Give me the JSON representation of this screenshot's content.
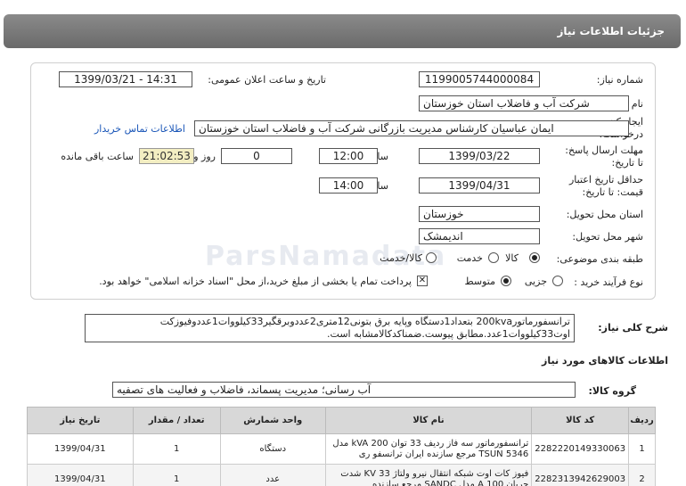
{
  "header": {
    "title": "جزئیات اطلاعات نیاز"
  },
  "form": {
    "need_number_label": "شماره نیاز:",
    "need_number": "1199005744000084",
    "announce_label": "تاریخ و ساعت اعلان عمومی:",
    "announce_value": "1399/03/21 - 14:31",
    "buyer_label": "نام دستگاه خریدار:",
    "buyer_value": "شرکت آب و فاضلاب استان خوزستان",
    "creator_label_1": "ایجاد کننده",
    "creator_label_2": "درخواست:",
    "creator_value": "ایمان عباسیان کارشناس مدیریت بازرگانی شرکت آب و فاضلاب استان خوزستان",
    "contact_link": "اطلاعات تماس خریدار",
    "reply_label_1": "مهلت ارسال پاسخ:",
    "reply_label_2": "تا تاریخ:",
    "reply_date": "1399/03/22",
    "time_label": "ساعت",
    "reply_time": "12:00",
    "days_value": "0",
    "days_label": "روز و",
    "remaining_time": "21:02:53",
    "remaining_label": "ساعت باقی مانده",
    "validity_label_1": "حداقل تاریخ اعتبار",
    "validity_label_2": "قیمت: تا تاریخ:",
    "validity_date": "1399/04/31",
    "validity_time": "14:00",
    "province_label": "استان محل تحویل:",
    "province_value": "خوزستان",
    "city_label": "شهر محل تحویل:",
    "city_value": "اندیمشک",
    "category_label": "طبقه بندی موضوعی:",
    "category_options": [
      "کالا",
      "خدمت",
      "کالا/خدمت"
    ],
    "process_label": "نوع فرآیند خرید :",
    "process_options": [
      "جزیی",
      "متوسط"
    ],
    "payment_note": "پرداخت تمام یا بخشی از مبلغ خرید،از محل \"اسناد خزانه اسلامی\" خواهد بود."
  },
  "description": {
    "label": "شرح کلی نیاز:",
    "text": "ترانسفورماتور200kva بتعداد1دستگاه وپایه برق بتونی12متری2عددوبرقگیر33کیلووات1عددوفیوزکت اوت33کیلووات1عدد.مطابق پیوست.ضمناکدکالامشابه است."
  },
  "goods_section": {
    "title": "اطلاعات کالاهای مورد نیاز",
    "group_label": "گروه کالا:",
    "group_value": "آب رسانی؛ مدیریت پسماند، فاضلاب و فعالیت های تصفیه"
  },
  "table": {
    "headers": [
      "ردیف",
      "کد کالا",
      "نام کالا",
      "واحد شمارش",
      "تعداد / مقدار",
      "تاریخ نیاز"
    ],
    "rows": [
      {
        "index": "1",
        "code": "2282220149330063",
        "name": "ترانسفورماتور سه فاز ردیف 33 توان 200 kVA مدل TSUN 5346 مرجع سازنده ایران ترانسفو ری",
        "unit": "دستگاه",
        "qty": "1",
        "date": "1399/04/31"
      },
      {
        "index": "2",
        "code": "2282313942629003",
        "name": "فیوز کات اوت شبکه انتقال نیرو ولتاژ 33 KV شدت جریان 100 A مدل SANDC مرجع سازنده",
        "unit": "عدد",
        "qty": "1",
        "date": "1399/04/31"
      }
    ]
  },
  "watermark": "ParsNamadata"
}
